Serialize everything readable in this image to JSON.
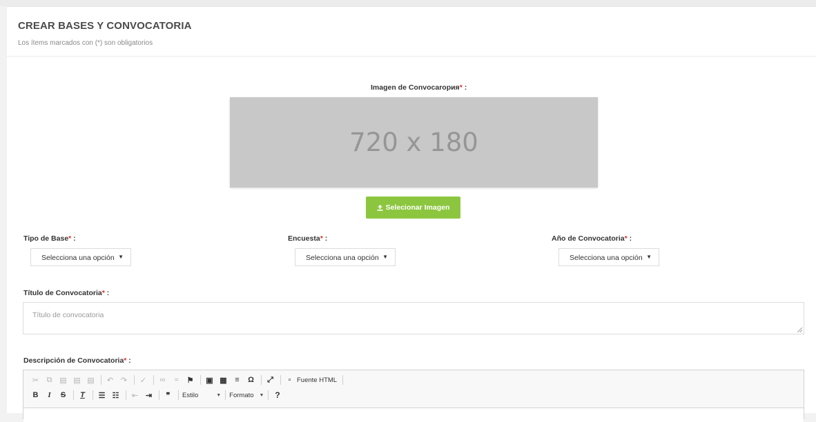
{
  "header": {
    "title": "CREAR BASES Y CONVOCATORIA",
    "subtitle": "Los ítems marcados con (*) son obligatorios"
  },
  "image_section": {
    "label": "Imagen de Convocarория",
    "placeholder_text": "720 x 180",
    "upload_button": "Selecionar Imagen"
  },
  "fields": {
    "tipo_base": {
      "label": "Tipo de Base",
      "value": "Selecciona una opción"
    },
    "encuesta": {
      "label": "Encuesta",
      "value": "Selecciona una opción"
    },
    "anio": {
      "label": "Año de Convocatoria",
      "value": "Selecciona una opción"
    },
    "titulo": {
      "label": "Título de Convocatoria",
      "placeholder": "Título de convocatoria"
    },
    "descripcion": {
      "label": "Descripción de Convocatoria"
    }
  },
  "required_mark": "*",
  "label_suffix": " :",
  "editor": {
    "source_label": "Fuente HTML",
    "style_combo": "Estilo",
    "format_combo": "Formato",
    "help": "?"
  },
  "colors": {
    "accent_green": "#8cc63f",
    "required_red": "#d9312b",
    "placeholder_gray": "#c8c8c8"
  }
}
